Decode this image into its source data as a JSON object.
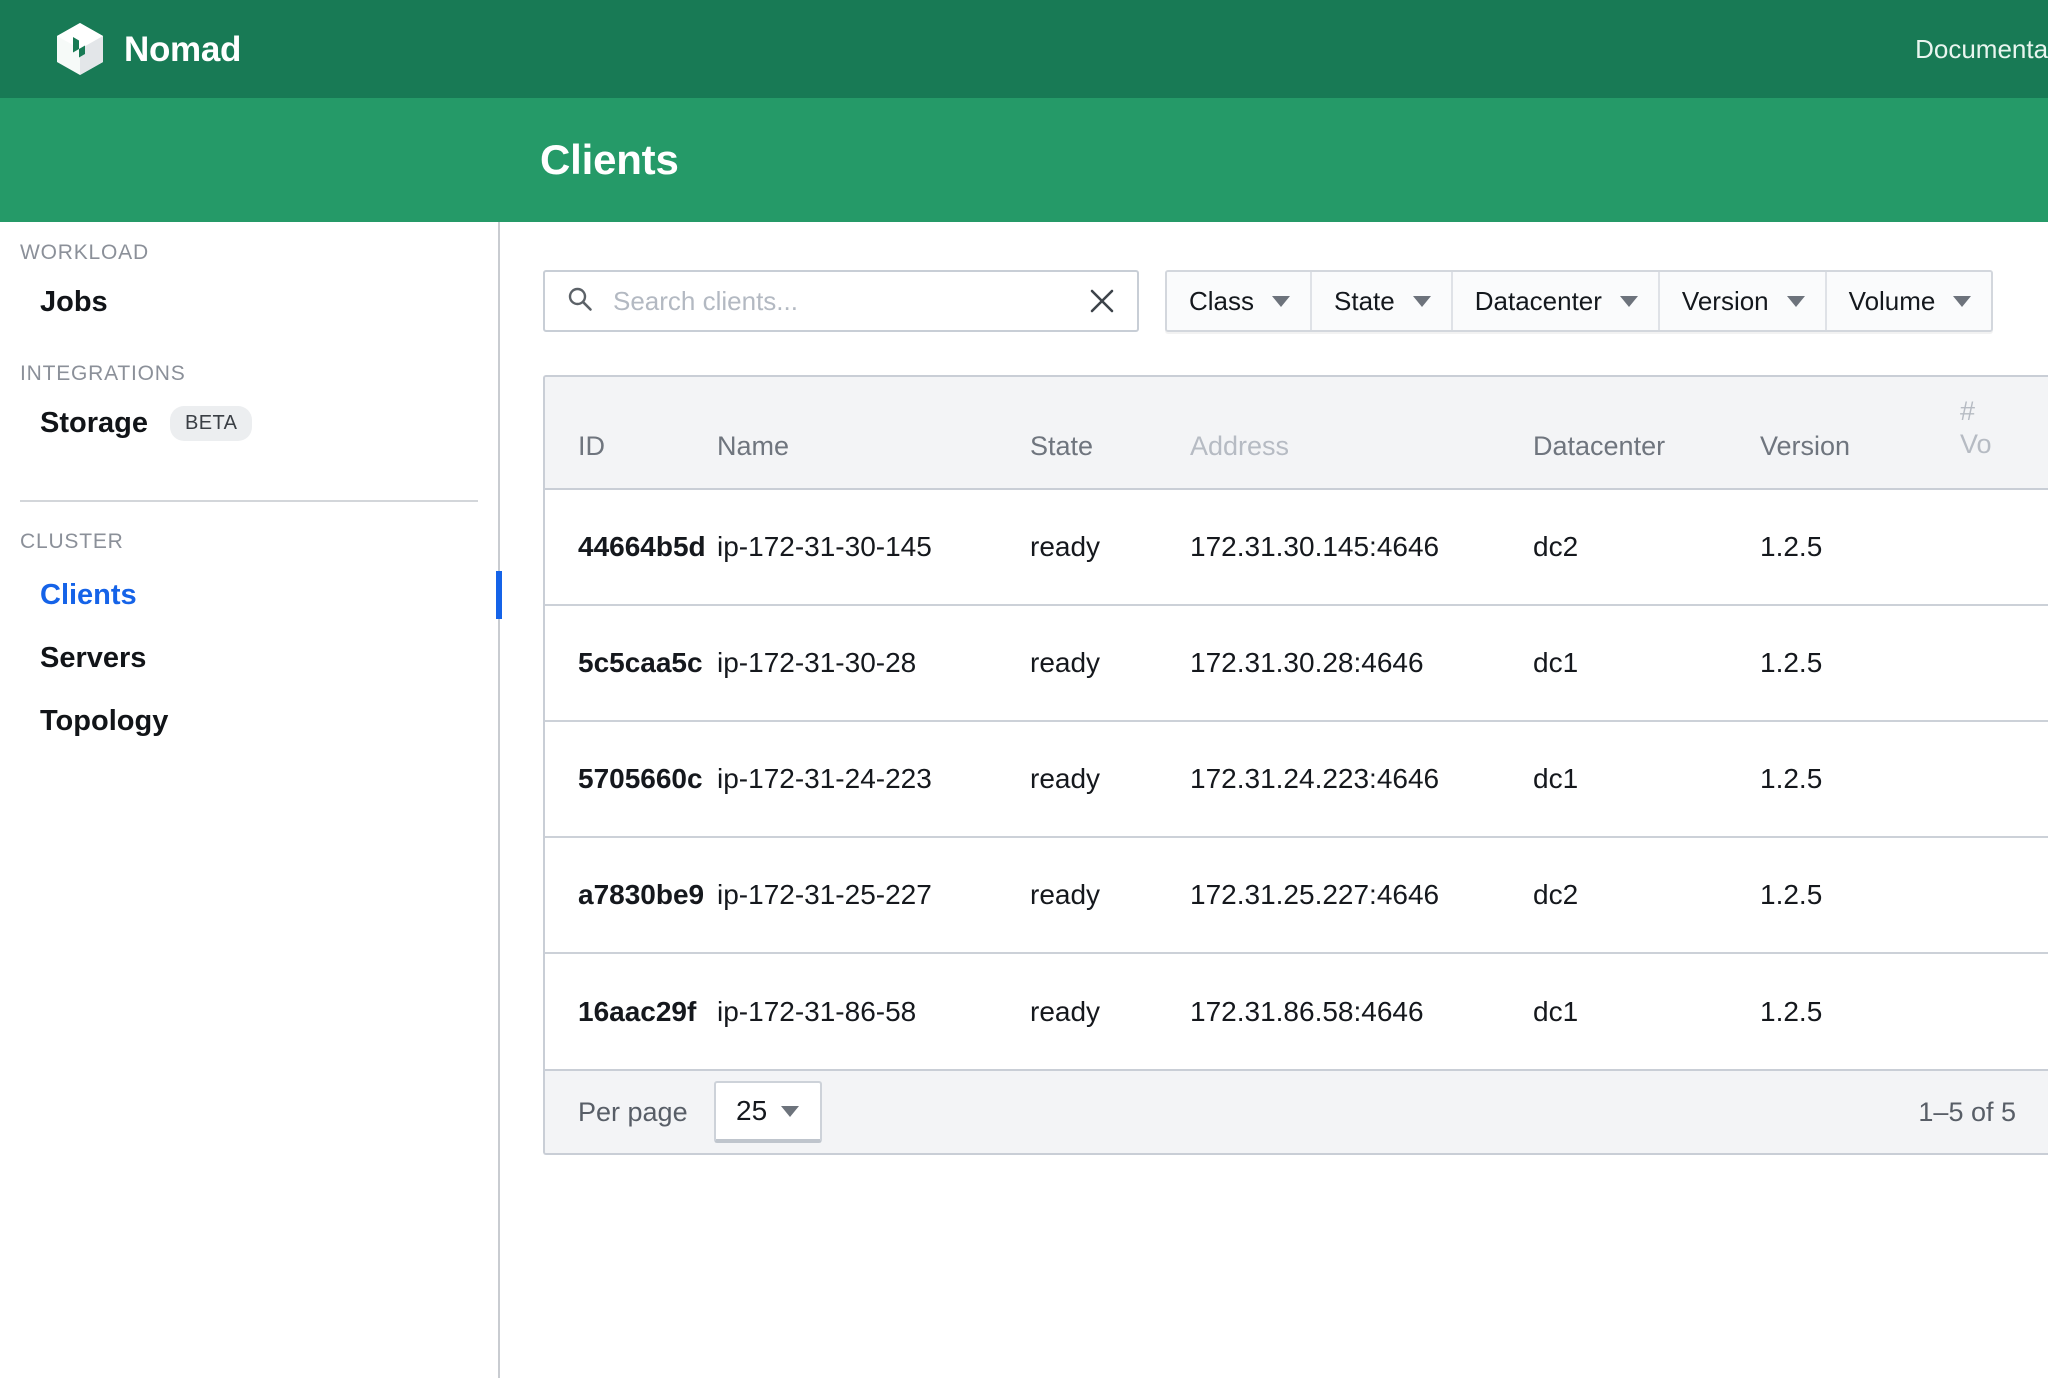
{
  "topbar": {
    "brand": "Nomad",
    "links": [
      "Documentation"
    ]
  },
  "subheader": {
    "title": "Clients"
  },
  "sidebar": {
    "sections": [
      {
        "label": "WORKLOAD",
        "items": [
          {
            "label": "Jobs",
            "active": false,
            "badge": null
          }
        ]
      },
      {
        "label": "INTEGRATIONS",
        "items": [
          {
            "label": "Storage",
            "active": false,
            "badge": "BETA"
          }
        ]
      },
      {
        "label": "CLUSTER",
        "items": [
          {
            "label": "Clients",
            "active": true,
            "badge": null
          },
          {
            "label": "Servers",
            "active": false,
            "badge": null
          },
          {
            "label": "Topology",
            "active": false,
            "badge": null
          }
        ]
      }
    ]
  },
  "toolbar": {
    "search": {
      "placeholder": "Search clients...",
      "value": "",
      "clear_icon": "close-icon",
      "search_icon": "search-icon"
    },
    "filters": [
      {
        "label": "Class"
      },
      {
        "label": "State"
      },
      {
        "label": "Datacenter"
      },
      {
        "label": "Version"
      },
      {
        "label": "Volume"
      }
    ]
  },
  "table": {
    "columns": [
      {
        "key": "id",
        "label": "ID",
        "muted": false
      },
      {
        "key": "name",
        "label": "Name",
        "muted": false
      },
      {
        "key": "state",
        "label": "State",
        "muted": false
      },
      {
        "key": "address",
        "label": "Address",
        "muted": true
      },
      {
        "key": "datacenter",
        "label": "Datacenter",
        "muted": false
      },
      {
        "key": "version",
        "label": "Version",
        "muted": false
      },
      {
        "key": "volumes",
        "label": "# Vo",
        "label_line1": "#",
        "label_line2": "Vo",
        "muted": true
      }
    ],
    "rows": [
      {
        "id": "44664b5d",
        "name": "ip-172-31-30-145",
        "state": "ready",
        "address": "172.31.30.145:4646",
        "datacenter": "dc2",
        "version": "1.2.5",
        "volumes": ""
      },
      {
        "id": "5c5caa5c",
        "name": "ip-172-31-30-28",
        "state": "ready",
        "address": "172.31.30.28:4646",
        "datacenter": "dc1",
        "version": "1.2.5",
        "volumes": ""
      },
      {
        "id": "5705660c",
        "name": "ip-172-31-24-223",
        "state": "ready",
        "address": "172.31.24.223:4646",
        "datacenter": "dc1",
        "version": "1.2.5",
        "volumes": ""
      },
      {
        "id": "a7830be9",
        "name": "ip-172-31-25-227",
        "state": "ready",
        "address": "172.31.25.227:4646",
        "datacenter": "dc2",
        "version": "1.2.5",
        "volumes": ""
      },
      {
        "id": "16aac29f",
        "name": "ip-172-31-86-58",
        "state": "ready",
        "address": "172.31.86.58:4646",
        "datacenter": "dc1",
        "version": "1.2.5",
        "volumes": ""
      }
    ]
  },
  "pagination": {
    "per_page_label": "Per page",
    "per_page_value": "25",
    "range_label": "1–5 of 5"
  },
  "colors": {
    "topbar_green": "#187a55",
    "subheader_green": "#259a68",
    "active_blue": "#1563e8",
    "border_gray": "#c9ced6",
    "header_bg": "#f3f4f6"
  }
}
